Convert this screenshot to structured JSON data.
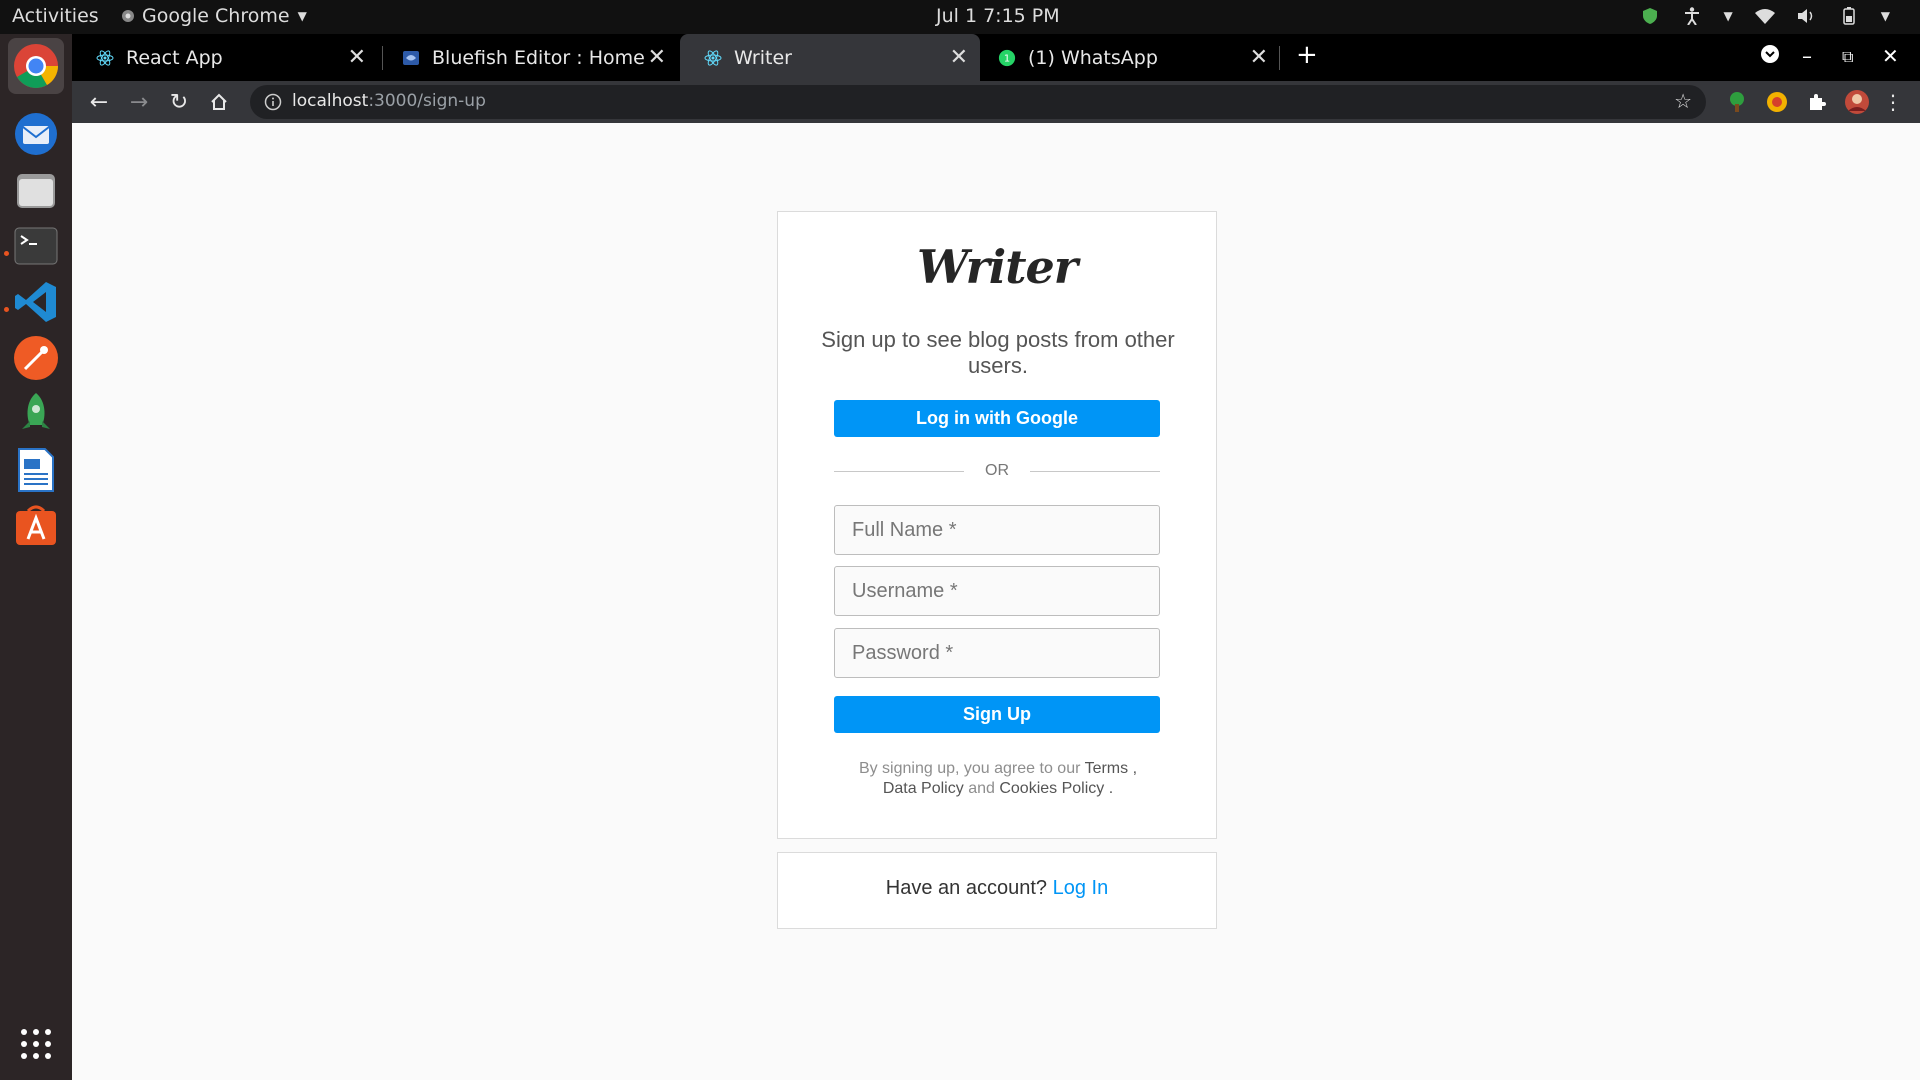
{
  "topbar": {
    "activities": "Activities",
    "app_menu": "Google Chrome",
    "clock": "Jul 1  7:15 PM"
  },
  "dock": {
    "items": [
      "chrome-icon",
      "thunderbird-icon",
      "files-icon",
      "terminal-icon",
      "vscode-icon",
      "postman-icon",
      "rocket-icon",
      "writer-doc-icon",
      "app-store-icon",
      "show-apps-icon"
    ]
  },
  "browser": {
    "tabs": [
      {
        "label": "React App",
        "favicon": "react-icon"
      },
      {
        "label": "Bluefish Editor : Home",
        "favicon": "bluefish-icon"
      },
      {
        "label": "Writer",
        "favicon": "react-icon"
      },
      {
        "label": "(1) WhatsApp",
        "favicon": "whatsapp-icon"
      }
    ],
    "url_host": "localhost",
    "url_path": ":3000/sign-up"
  },
  "signup": {
    "logo": "Writer",
    "tagline": "Sign up to see blog posts from other users.",
    "google_button": "Log in with Google",
    "or": "OR",
    "full_name_placeholder": "Full Name *",
    "username_placeholder": "Username *",
    "password_placeholder": "Password *",
    "signup_button": "Sign Up",
    "legal_prefix": "By signing up, you agree to our",
    "terms": "Terms",
    "comma": ",",
    "data_policy": "Data Policy",
    "and": "and",
    "cookies_policy": "Cookies Policy",
    "period": "."
  },
  "login": {
    "prompt": "Have an account?",
    "link": "Log In"
  },
  "colors": {
    "primary": "#0095f6",
    "ubuntu_orange": "#e95420"
  }
}
